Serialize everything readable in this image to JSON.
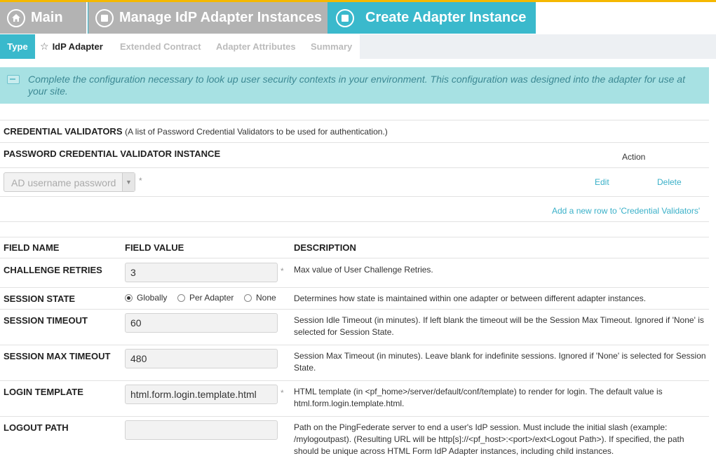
{
  "breadcrumbs": {
    "main": "Main",
    "manage": "Manage IdP Adapter Instances",
    "create": "Create Adapter Instance"
  },
  "tabs": {
    "type": "Type",
    "idp_adapter": "IdP Adapter",
    "extended_contract": "Extended Contract",
    "adapter_attributes": "Adapter Attributes",
    "summary": "Summary"
  },
  "banner": {
    "text": "Complete the configuration necessary to look up user security contexts in your environment. This configuration was designed into the adapter for use at your site."
  },
  "credential_validators": {
    "title": "CREDENTIAL VALIDATORS",
    "subtitle": "(A list of Password Credential Validators to be used for authentication.)",
    "column_instance": "PASSWORD CREDENTIAL VALIDATOR INSTANCE",
    "column_action": "Action",
    "selected_instance": "AD username password",
    "required_mark": "*",
    "edit_label": "Edit",
    "delete_label": "Delete",
    "add_row_label": "Add a new row to 'Credential Validators'"
  },
  "fields_table": {
    "col_name": "FIELD NAME",
    "col_value": "FIELD VALUE",
    "col_description": "DESCRIPTION",
    "challenge_retries": {
      "name": "CHALLENGE RETRIES",
      "value": "3",
      "required_mark": "*",
      "description": "Max value of User Challenge Retries."
    },
    "session_state": {
      "name": "SESSION STATE",
      "options": [
        "Globally",
        "Per Adapter",
        "None"
      ],
      "selected": "Globally",
      "description": "Determines how state is maintained within one adapter or between different adapter instances."
    },
    "session_timeout": {
      "name": "SESSION TIMEOUT",
      "value": "60",
      "description": "Session Idle Timeout (in minutes). If left blank the timeout will be the Session Max Timeout. Ignored if 'None' is selected for Session State."
    },
    "session_max_timeout": {
      "name": "SESSION MAX TIMEOUT",
      "value": "480",
      "description": "Session Max Timeout (in minutes). Leave blank for indefinite sessions. Ignored if 'None' is selected for Session State."
    },
    "login_template": {
      "name": "LOGIN TEMPLATE",
      "value": "html.form.login.template.html",
      "required_mark": "*",
      "description": "HTML template (in <pf_home>/server/default/conf/template) to render for login. The default value is html.form.login.template.html."
    },
    "logout_path": {
      "name": "LOGOUT PATH",
      "value": "",
      "description": "Path on the PingFederate server to end a user's IdP session. Must include the initial slash (example: /mylogoutpast). (Resulting URL will be http[s]://<pf_host>:<port>/ext<Logout Path>). If specified, the path should be unique across HTML Form IdP Adapter instances, including child instances."
    }
  },
  "colors": {
    "accent": "#3ab9cc",
    "inactive_crumb": "#b3b3b3",
    "banner_bg": "#a7e1e3",
    "top_stripe": "#f5b800",
    "link": "#3ab0c8"
  }
}
